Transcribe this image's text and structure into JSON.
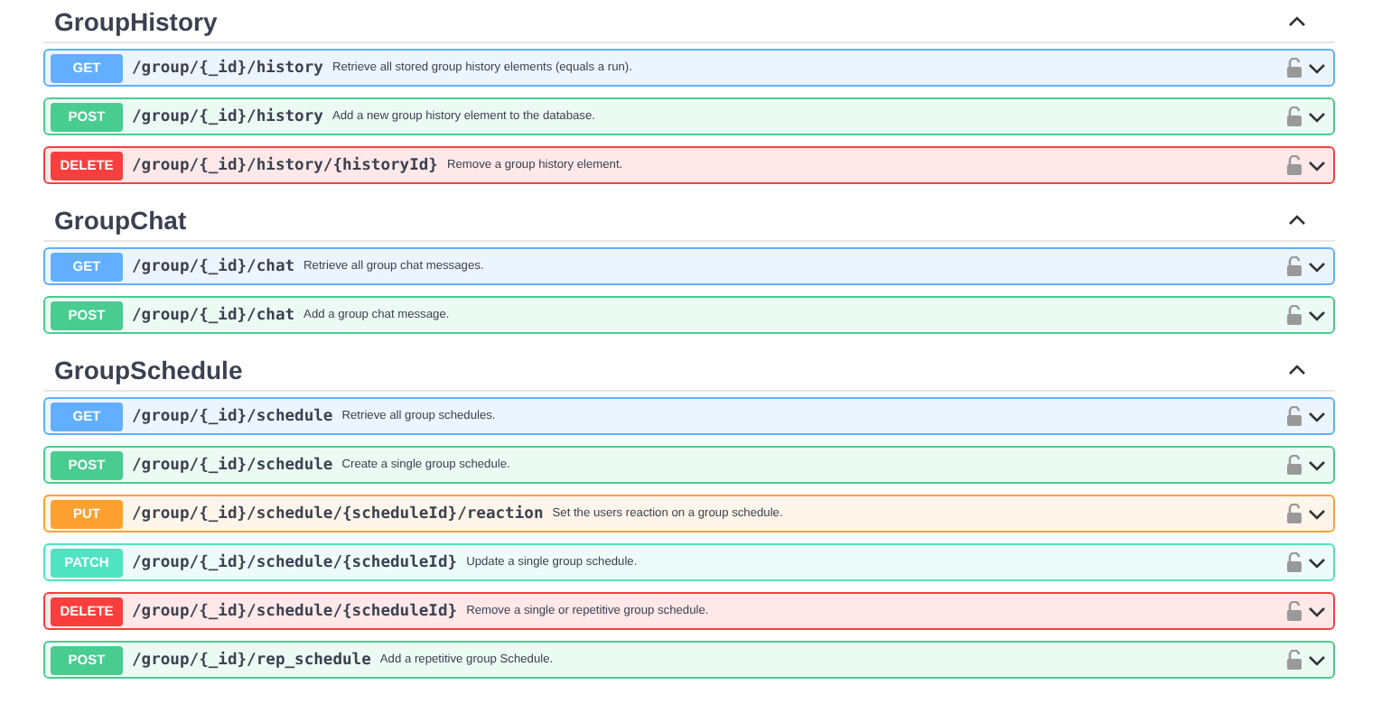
{
  "sections": [
    {
      "name": "GroupHistory",
      "expanded": true,
      "operations": [
        {
          "method": "GET",
          "path": "/group/{_id}/history",
          "summary": "Retrieve all stored group history elements (equals a run)."
        },
        {
          "method": "POST",
          "path": "/group/{_id}/history",
          "summary": "Add a new group history element to the database."
        },
        {
          "method": "DELETE",
          "path": "/group/{_id}/history/{historyId}",
          "summary": "Remove a group history element."
        }
      ]
    },
    {
      "name": "GroupChat",
      "expanded": true,
      "operations": [
        {
          "method": "GET",
          "path": "/group/{_id}/chat",
          "summary": "Retrieve all group chat messages."
        },
        {
          "method": "POST",
          "path": "/group/{_id}/chat",
          "summary": "Add a group chat message."
        }
      ]
    },
    {
      "name": "GroupSchedule",
      "expanded": true,
      "operations": [
        {
          "method": "GET",
          "path": "/group/{_id}/schedule",
          "summary": "Retrieve all group schedules."
        },
        {
          "method": "POST",
          "path": "/group/{_id}/schedule",
          "summary": "Create a single group schedule."
        },
        {
          "method": "PUT",
          "path": "/group/{_id}/schedule/{scheduleId}/reaction",
          "summary": "Set the users reaction on a group schedule."
        },
        {
          "method": "PATCH",
          "path": "/group/{_id}/schedule/{scheduleId}",
          "summary": "Update a single group schedule."
        },
        {
          "method": "DELETE",
          "path": "/group/{_id}/schedule/{scheduleId}",
          "summary": "Remove a single or repetitive group schedule."
        },
        {
          "method": "POST",
          "path": "/group/{_id}/rep_schedule",
          "summary": "Add a repetitive group Schedule."
        }
      ]
    }
  ]
}
